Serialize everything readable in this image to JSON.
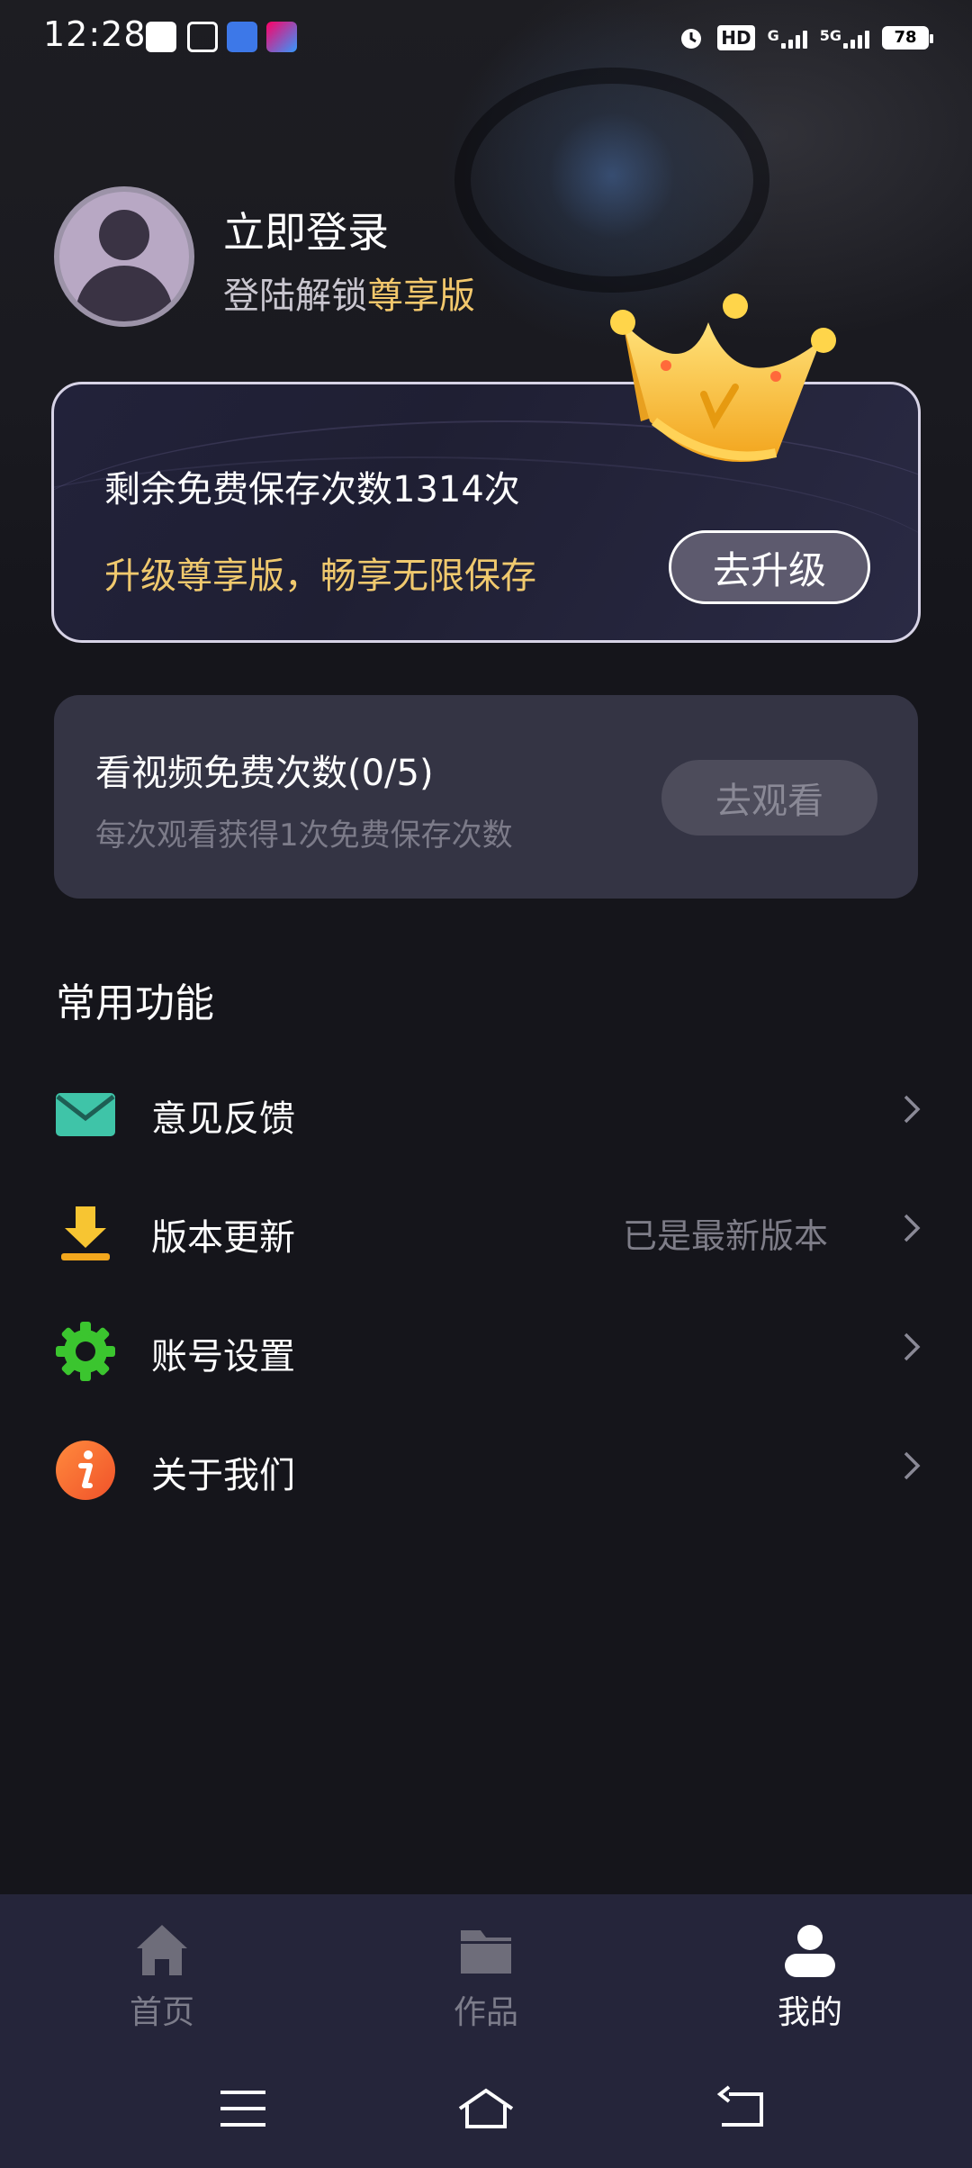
{
  "status_bar": {
    "time": "12:28",
    "network_1": "G",
    "network_2": "5G",
    "hd": "HD",
    "battery": "78"
  },
  "profile": {
    "title": "立即登录",
    "subtitle_prefix": "登陆解锁",
    "subtitle_highlight": "尊享版"
  },
  "vip_card": {
    "remaining": "剩余免费保存次数1314次",
    "promo": "升级尊享版，畅享无限保存",
    "button": "去升级"
  },
  "video_card": {
    "title": "看视频免费次数(0/5)",
    "subtitle": "每次观看获得1次免费保存次数",
    "button": "去观看"
  },
  "section": {
    "title": "常用功能",
    "items": [
      {
        "label": "意见反馈",
        "value": "",
        "icon": "mail-icon"
      },
      {
        "label": "版本更新",
        "value": "已是最新版本",
        "icon": "download-icon"
      },
      {
        "label": "账号设置",
        "value": "",
        "icon": "gear-icon"
      },
      {
        "label": "关于我们",
        "value": "",
        "icon": "info-icon"
      }
    ]
  },
  "tabs": [
    {
      "label": "首页",
      "icon": "home-icon",
      "active": false
    },
    {
      "label": "作品",
      "icon": "folder-icon",
      "active": false
    },
    {
      "label": "我的",
      "icon": "user-icon",
      "active": true
    }
  ],
  "colors": {
    "background": "#15151b",
    "accent_gold": "#f3c86c",
    "card": "#343444",
    "tab_bar": "#25253a"
  }
}
